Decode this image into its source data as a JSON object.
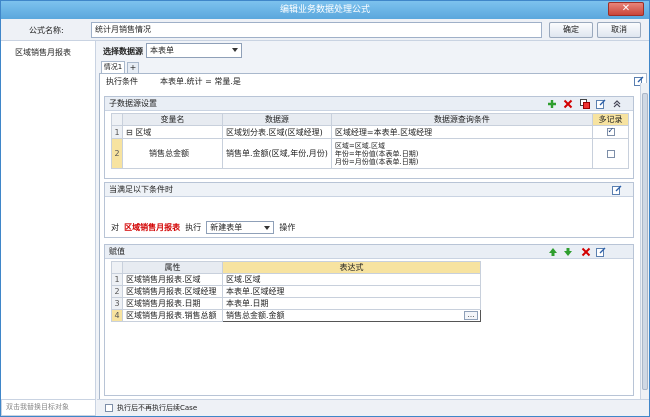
{
  "window": {
    "title": "编辑业务数据处理公式",
    "close": "✕"
  },
  "formula": {
    "label": "公式名称:",
    "value": "统计月销售情况",
    "ok": "确定",
    "cancel": "取消"
  },
  "left": {
    "item": "区域销售月报表",
    "search_placeholder": "双击我替换目标对象"
  },
  "datasource": {
    "label": "选择数据源",
    "value": "本表单"
  },
  "tabs": {
    "active": "情况1",
    "add": "+"
  },
  "exec_condition": {
    "label": "执行条件",
    "value": "本表单.统计 = 常量.是"
  },
  "sub_ds": {
    "title": "子数据源设置",
    "headers": [
      "变量名",
      "数据源",
      "数据源查询条件",
      "多记录"
    ],
    "rows": [
      {
        "num": "1",
        "name": "⊟ 区域",
        "source": "区域划分表.区域(区域经理)",
        "cond": [
          "区域经理=本表单.区域经理"
        ],
        "multi": true
      },
      {
        "num": "2",
        "name": "销售总金额",
        "source": "销售单.金额(区域,年份,月份)",
        "cond": [
          "区域=区域.区域",
          "年份=年份值(本表单.日期)",
          "月份=月份值(本表单.日期)"
        ],
        "multi": false
      }
    ]
  },
  "when": {
    "title": "当满足以下条件时"
  },
  "action": {
    "prefix": "对",
    "target": "区域销售月报表",
    "exec": "执行",
    "op": "新建表单",
    "suffix": "操作"
  },
  "assign": {
    "title": "赋值",
    "headers": [
      "属性",
      "表达式"
    ],
    "rows": [
      {
        "num": "1",
        "prop": "区域销售月报表.区域",
        "expr": "区域.区域"
      },
      {
        "num": "2",
        "prop": "区域销售月报表.区域经理",
        "expr": "本表单.区域经理"
      },
      {
        "num": "3",
        "prop": "区域销售月报表.日期",
        "expr": "本表单.日期"
      },
      {
        "num": "4",
        "prop": "区域销售月报表.销售总额",
        "expr": "销售总金额.金额"
      }
    ]
  },
  "bottom": {
    "checkbox_label": "执行后不再执行后续Case"
  },
  "colors": {
    "accent": "#5aa7dd",
    "red": "#d20000",
    "green": "#2e9e2e",
    "highlight": "#f7e3a0"
  }
}
